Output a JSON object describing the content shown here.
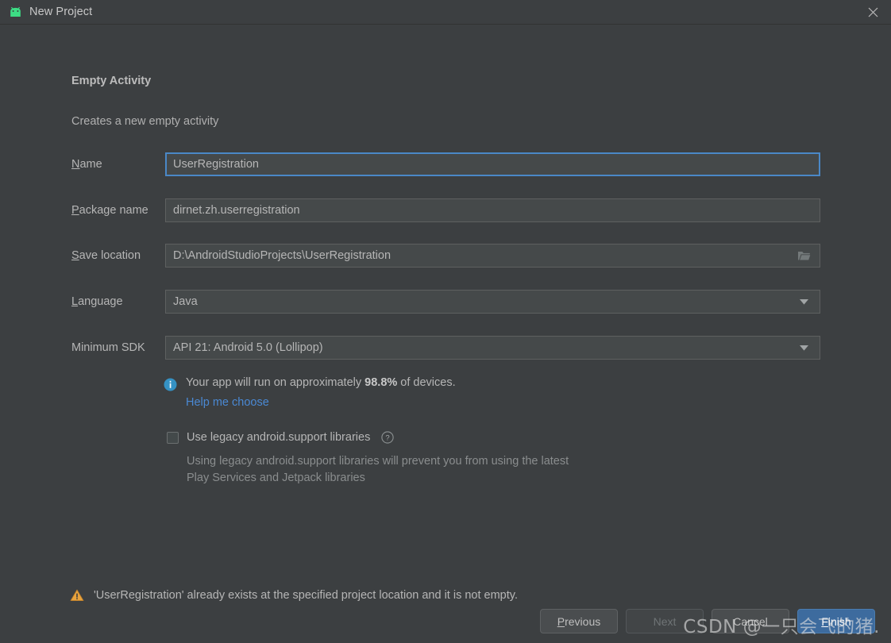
{
  "window": {
    "title": "New Project",
    "app_icon": "android-robot-icon",
    "close_icon": "close-icon"
  },
  "page": {
    "heading": "Empty Activity",
    "subheading": "Creates a new empty activity"
  },
  "form": {
    "name": {
      "label_prefix": "",
      "label_mnemonic": "N",
      "label_suffix": "ame",
      "value": "UserRegistration"
    },
    "package_name": {
      "label_prefix": "",
      "label_mnemonic": "P",
      "label_suffix": "ackage name",
      "value": "dirnet.zh.userregistration"
    },
    "save_location": {
      "label_prefix": "",
      "label_mnemonic": "S",
      "label_suffix": "ave location",
      "value": "D:\\AndroidStudioProjects\\UserRegistration",
      "browse_icon": "folder-icon"
    },
    "language": {
      "label_prefix": "",
      "label_mnemonic": "L",
      "label_suffix": "anguage",
      "value": "Java",
      "arrow_icon": "chevron-down-icon"
    },
    "minimum_sdk": {
      "label_prefix": "Minimum SDK",
      "label_mnemonic": "",
      "label_suffix": "",
      "value": "API 21: Android 5.0 (Lollipop)",
      "arrow_icon": "chevron-down-icon"
    }
  },
  "info": {
    "icon": "info-icon",
    "text_before": "Your app will run on approximately ",
    "percent": "98.8%",
    "text_after": " of devices.",
    "help_link": "Help me choose"
  },
  "legacy": {
    "checkbox_checked": false,
    "label": "Use legacy android.support libraries",
    "help_icon": "question-mark-icon",
    "description": "Using legacy android.support libraries will prevent you from using the latest Play Services and Jetpack libraries"
  },
  "warning": {
    "icon": "warning-triangle-icon",
    "text": "'UserRegistration' already exists at the specified project location and it is not empty."
  },
  "buttons": {
    "previous": {
      "prefix": "",
      "mnemonic": "P",
      "suffix": "revious"
    },
    "next": {
      "label": "Next",
      "disabled": true
    },
    "cancel": {
      "label": "Cancel"
    },
    "finish": {
      "prefix": "",
      "mnemonic": "F",
      "suffix": "inish"
    }
  },
  "watermark": {
    "text": "CSDN @一只会飞的猪."
  },
  "colors": {
    "background": "#3c3f41",
    "field_background": "#45494a",
    "focus_border": "#4a88c7",
    "link": "#4a89d4",
    "primary_button": "#3d6b9e",
    "warning": "#e8a33d",
    "android_green": "#3ddc84"
  }
}
